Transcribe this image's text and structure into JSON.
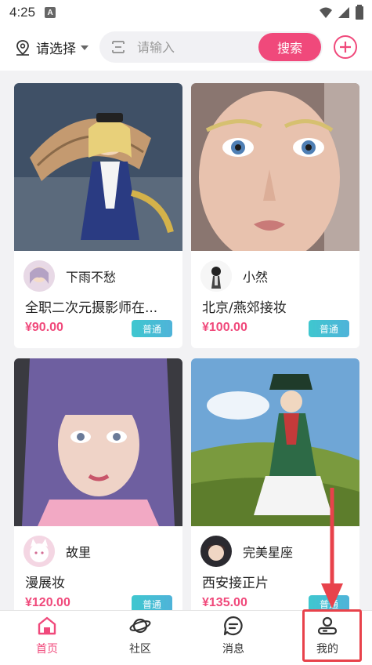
{
  "status_bar": {
    "time": "4:25",
    "badge": "A"
  },
  "header": {
    "location_label": "请选择",
    "search_placeholder": "请输入",
    "search_value": "",
    "search_button_label": "搜索"
  },
  "cards": [
    {
      "author": "下雨不愁",
      "title": "全职二次元摄影师在...",
      "price": "¥90.00",
      "tag": "普通"
    },
    {
      "author": "小然",
      "title": "北京/燕郊接妆",
      "price": "¥100.00",
      "tag": "普通"
    },
    {
      "author": "故里",
      "title": "漫展妆",
      "price": "¥120.00",
      "tag": "普通"
    },
    {
      "author": "完美星座",
      "title": "西安接正片",
      "price": "¥135.00",
      "tag": "普通"
    }
  ],
  "tabs": [
    {
      "label": "首页",
      "icon": "home-icon",
      "active": true
    },
    {
      "label": "社区",
      "icon": "planet-icon",
      "active": false
    },
    {
      "label": "消息",
      "icon": "chat-icon",
      "active": false
    },
    {
      "label": "我的",
      "icon": "profile-icon",
      "active": false
    }
  ],
  "colors": {
    "accent": "#f0497b",
    "tag": "#3fc7cf",
    "annotation": "#e8424b"
  }
}
